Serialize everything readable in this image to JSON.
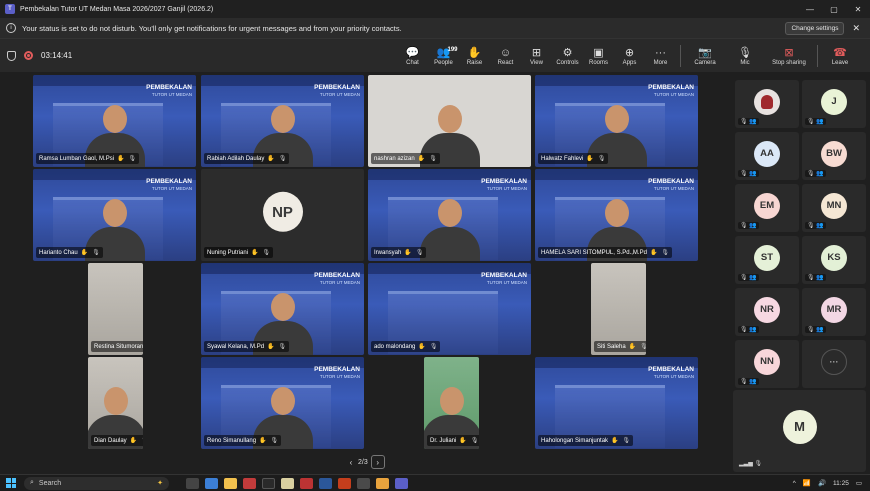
{
  "window": {
    "title": "Pembekalan Tutor UT Medan Masa 2026/2027 Ganjil (2026.2)",
    "app_icon": "T",
    "controls": [
      "—",
      "▢",
      "✕"
    ]
  },
  "notification": {
    "message": "Your status is set to do not disturb. You'll only get notifications for urgent messages and from your priority contacts.",
    "action_label": "Change settings",
    "close": "✕"
  },
  "toolbar": {
    "timer": "03:14:41",
    "buttons": [
      {
        "label": "Chat",
        "icon": "💬"
      },
      {
        "label": "People",
        "icon": "👥",
        "badge": "199"
      },
      {
        "label": "Raise",
        "icon": "✋"
      },
      {
        "label": "React",
        "icon": "☺"
      },
      {
        "label": "View",
        "icon": "⊞"
      },
      {
        "label": "Controls",
        "icon": "⚙"
      },
      {
        "label": "Rooms",
        "icon": "▣"
      },
      {
        "label": "Apps",
        "icon": "⊕"
      },
      {
        "label": "More",
        "icon": "···"
      }
    ],
    "camera_label": "Camera",
    "mic_label": "Mic",
    "stop_sharing_label": "Stop sharing",
    "leave_label": "Leave"
  },
  "banner": {
    "line1": "PEMBEKALAN",
    "line2": "TUTOR UT MEDAN"
  },
  "tiles": [
    {
      "name": "Ramsa Lumban Gaol, M.Psi",
      "bg": "blue",
      "person": true
    },
    {
      "name": "Rabiah Adilah Daulay",
      "bg": "blue",
      "person": true
    },
    {
      "name": "nashran azizan",
      "bg": "light",
      "person": true
    },
    {
      "name": "Halwatz Fahlevi",
      "bg": "blue",
      "person": true
    },
    {
      "name": "Harianto Chau",
      "bg": "blue",
      "person": true
    },
    {
      "name": "Nuning Putriani",
      "bg": "dark",
      "initials": "NP"
    },
    {
      "name": "Irwansyah",
      "bg": "blue",
      "person": true
    },
    {
      "name": "HAMELA SARI SITOMPUL, S.Pd.,M.Pd",
      "bg": "blue",
      "person": true
    },
    {
      "name": "Restina Situmorang",
      "bg": "wall"
    },
    {
      "name": "Syawal Kelana, M.Pd",
      "bg": "blue",
      "person": true
    },
    {
      "name": "ado malondang",
      "bg": "blue"
    },
    {
      "name": "Siti Saleha",
      "bg": "wall"
    },
    {
      "name": "Dian Daulay",
      "bg": "wall",
      "person": true
    },
    {
      "name": "Reno Simanullang",
      "bg": "blue",
      "person": true
    },
    {
      "name": "Dr. Juliani",
      "bg": "green",
      "person": true
    },
    {
      "name": "Haholongan Simanjuntak",
      "bg": "blue"
    }
  ],
  "pager": {
    "label": "2/3",
    "prev": "‹",
    "next": "›"
  },
  "side_participants": [
    {
      "initials": "",
      "color": "#e8e2e0",
      "photo": true
    },
    {
      "initials": "J",
      "color": "#e9f3d6"
    },
    {
      "initials": "AA",
      "color": "#dbe8f7"
    },
    {
      "initials": "BW",
      "color": "#f7dbd2"
    },
    {
      "initials": "EM",
      "color": "#f7d6d2"
    },
    {
      "initials": "MN",
      "color": "#f5e7d4"
    },
    {
      "initials": "ST",
      "color": "#e5f1d8"
    },
    {
      "initials": "KS",
      "color": "#e3f0d6"
    },
    {
      "initials": "NR",
      "color": "#f7d8e2"
    },
    {
      "initials": "MR",
      "color": "#f3d7e4"
    },
    {
      "initials": "NN",
      "color": "#f8d6da"
    },
    {
      "initials": "···",
      "more": true
    }
  ],
  "big_participant": {
    "initials": "M",
    "color": "#eef2dc"
  },
  "taskbar": {
    "search_placeholder": "Search",
    "time": "11:25",
    "tray_icons": [
      "^",
      "📶",
      "🔊"
    ]
  },
  "colors": {
    "accent": "#5b5fc7",
    "leave": "#e25c5c",
    "tile_blue": "#3a5bb8"
  }
}
